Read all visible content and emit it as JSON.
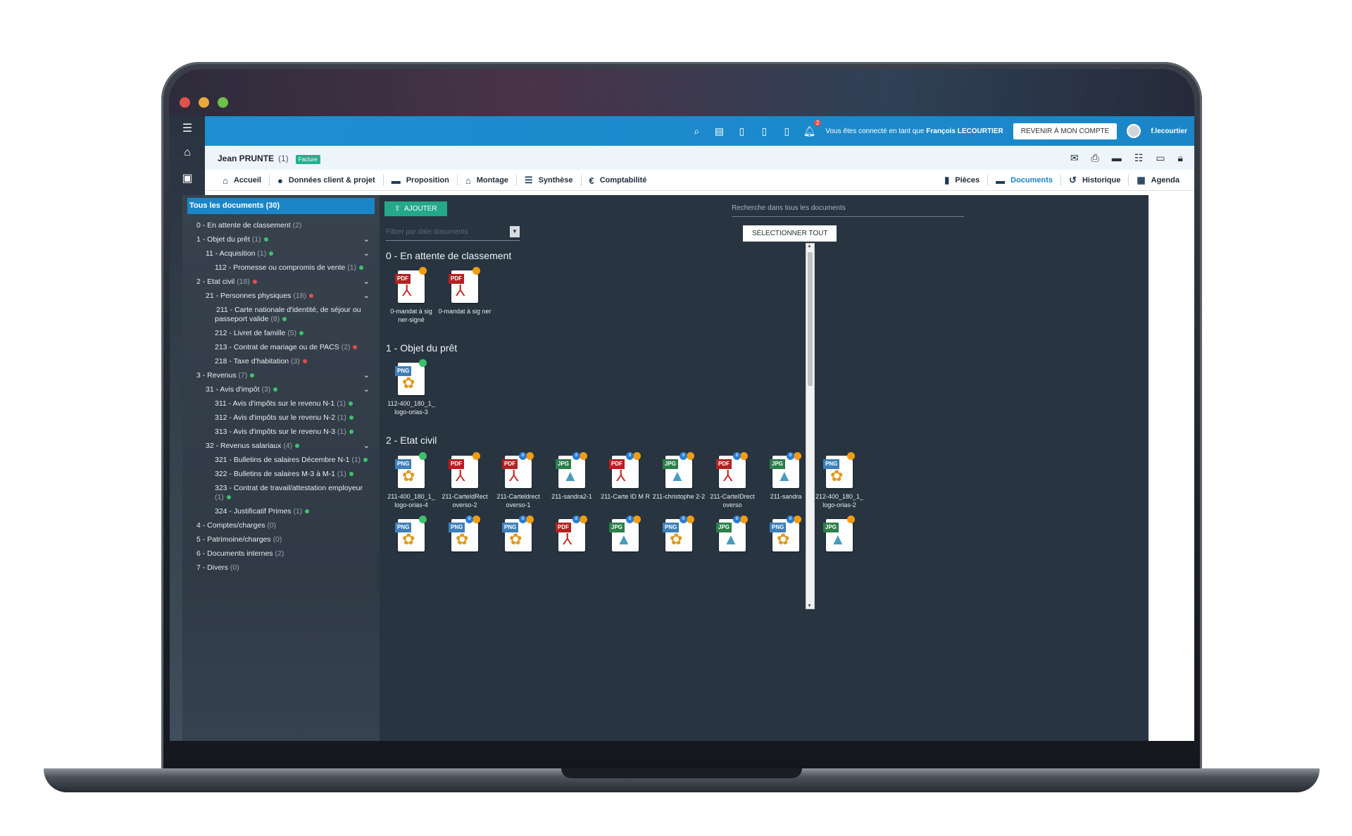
{
  "colors": {
    "topbar": "#1a86c8",
    "accent": "#23a98a",
    "status_green": "#3ec16b",
    "status_red": "#e24c4c",
    "status_orange": "#f39c12"
  },
  "rail": {
    "icons": [
      "menu-icon",
      "home-icon",
      "clipboard-icon",
      "euro-icon",
      "chart-icon",
      "calendar-icon",
      "gear-icon",
      "route-icon",
      "dashboard-icon"
    ]
  },
  "topbar": {
    "notifications": "2",
    "connected_prefix": "Vous êtes connecté en tant que",
    "connected_user": "François LECOURTIER",
    "back_button": "REVENIR À MON COMPTE",
    "username": "f.lecourtier"
  },
  "client": {
    "name": "Jean PRUNTE",
    "count": "(1)",
    "tag": "Facture"
  },
  "nav_left": [
    {
      "label": "Accueil",
      "icon": "home-icon"
    },
    {
      "label": "Données client & projet",
      "icon": "user-icon"
    },
    {
      "label": "Proposition",
      "icon": "chat-icon"
    },
    {
      "label": "Montage",
      "icon": "bank-icon"
    },
    {
      "label": "Synthèse",
      "icon": "list-icon"
    },
    {
      "label": "Comptabilité",
      "icon": "euro-icon"
    }
  ],
  "nav_right": [
    {
      "label": "Pièces",
      "icon": "file-icon"
    },
    {
      "label": "Documents",
      "icon": "folder-icon"
    },
    {
      "label": "Historique",
      "icon": "history-icon"
    },
    {
      "label": "Agenda",
      "icon": "calendar-icon"
    }
  ],
  "tree": {
    "header": "Tous les documents (30)",
    "items": [
      {
        "label": "0 - En attente de classement",
        "count": "(2)",
        "status": "",
        "chev": false
      },
      {
        "label": "1 - Objet du prêt",
        "count": "(1)",
        "status": "g",
        "chev": true
      },
      {
        "label": "11 - Acquisition",
        "count": "(1)",
        "status": "g",
        "chev": true
      },
      {
        "label": "112 - Promesse ou compromis de vente",
        "count": "(1)",
        "status": "g",
        "chev": false
      },
      {
        "label": "2 - Etat civil",
        "count": "(18)",
        "status": "r",
        "chev": true
      },
      {
        "label": "21 - Personnes physiques",
        "count": "(18)",
        "status": "r",
        "chev": true
      },
      {
        "label": "211 - Carte nationale d'identité, de séjour ou passeport valide",
        "count": "(8)",
        "status": "g",
        "chev": false
      },
      {
        "label": "212 - Livret de famille",
        "count": "(5)",
        "status": "g",
        "chev": false
      },
      {
        "label": "213 - Contrat de mariage ou de PACS",
        "count": "(2)",
        "status": "r",
        "chev": false
      },
      {
        "label": "218 - Taxe d'habitation",
        "count": "(3)",
        "status": "r",
        "chev": false
      },
      {
        "label": "3 - Revenus",
        "count": "(7)",
        "status": "g",
        "chev": true
      },
      {
        "label": "31 - Avis d'impôt",
        "count": "(3)",
        "status": "g",
        "chev": true
      },
      {
        "label": "311 - Avis d'impôts sur le revenu N-1",
        "count": "(1)",
        "status": "g",
        "chev": false
      },
      {
        "label": "312 - Avis d'impôts sur le revenu N-2",
        "count": "(1)",
        "status": "g",
        "chev": false
      },
      {
        "label": "313 - Avis d'impôts sur le revenu N-3",
        "count": "(1)",
        "status": "g",
        "chev": false
      },
      {
        "label": "32 - Revenus salariaux",
        "count": "(4)",
        "status": "g",
        "chev": true
      },
      {
        "label": "321 - Bulletins de salaires Décembre N-1",
        "count": "(1)",
        "status": "g",
        "chev": false
      },
      {
        "label": "322 - Bulletins de salaires M-3 à M-1",
        "count": "(1)",
        "status": "g",
        "chev": false
      },
      {
        "label": "323 - Contrat de travail/attestation employeur",
        "count": "(1)",
        "status": "g",
        "chev": false
      },
      {
        "label": "324 - Justificatif Primes",
        "count": "(1)",
        "status": "g",
        "chev": false
      },
      {
        "label": "4 - Comptes/charges",
        "count": "(0)",
        "status": "",
        "chev": false
      },
      {
        "label": "5 - Patrimoine/charges",
        "count": "(0)",
        "status": "",
        "chev": false
      },
      {
        "label": "6 - Documents internes",
        "count": "(2)",
        "status": "",
        "chev": false
      },
      {
        "label": "7 - Divers",
        "count": "(0)",
        "status": "",
        "chev": false
      }
    ]
  },
  "main": {
    "add_button": "AJOUTER",
    "filter_placeholder": "Filtrer par date documents",
    "search_placeholder": "Recherche dans tous les documents",
    "select_all": "SÉLECTIONNER TOUT",
    "sections": [
      {
        "title": "0 - En attente de classement",
        "files": [
          {
            "type": "PDF",
            "name": "0-mandat à sig ner-signé",
            "dot": "o",
            "badge": false
          },
          {
            "type": "PDF",
            "name": "0-mandat à sig ner",
            "dot": "o",
            "badge": false
          }
        ]
      },
      {
        "title": "1 - Objet du prêt",
        "files": [
          {
            "type": "PNG",
            "name": "112-400_180_1_ logo-orias-3",
            "dot": "g",
            "badge": false
          }
        ]
      },
      {
        "title": "2 - Etat civil",
        "files": [
          {
            "type": "PNG",
            "name": "211-400_180_1_ logo-orias-4",
            "dot": "g",
            "badge": false
          },
          {
            "type": "PDF",
            "name": "211-CarteIdRect overso-2",
            "dot": "o",
            "badge": false
          },
          {
            "type": "PDF",
            "name": "211-Carteldrect overso-1",
            "dot": "o",
            "badge": true
          },
          {
            "type": "JPG",
            "name": "211-sandra2-1",
            "dot": "o",
            "badge": true
          },
          {
            "type": "PDF",
            "name": "211-Carte ID M R",
            "dot": "o",
            "badge": true
          },
          {
            "type": "JPG",
            "name": "211-christophe 2-2",
            "dot": "o",
            "badge": true
          },
          {
            "type": "PDF",
            "name": "211-CarteIDrect overso",
            "dot": "o",
            "badge": true
          },
          {
            "type": "JPG",
            "name": "211-sandra",
            "dot": "o",
            "badge": true
          },
          {
            "type": "PNG",
            "name": "212-400_180_1_ logo-orias-2",
            "dot": "o",
            "badge": false
          }
        ]
      },
      {
        "title": "",
        "files": [
          {
            "type": "PNG",
            "name": "",
            "dot": "g",
            "badge": false
          },
          {
            "type": "PNG",
            "name": "",
            "dot": "o",
            "badge": true
          },
          {
            "type": "PNG",
            "name": "",
            "dot": "o",
            "badge": true
          },
          {
            "type": "PDF",
            "name": "",
            "dot": "o",
            "badge": true
          },
          {
            "type": "JPG",
            "name": "",
            "dot": "o",
            "badge": true
          },
          {
            "type": "PNG",
            "name": "",
            "dot": "o",
            "badge": true
          },
          {
            "type": "JPG",
            "name": "",
            "dot": "o",
            "badge": true
          },
          {
            "type": "PNG",
            "name": "",
            "dot": "o",
            "badge": true
          },
          {
            "type": "JPG",
            "name": "",
            "dot": "o",
            "badge": false
          }
        ]
      }
    ]
  }
}
